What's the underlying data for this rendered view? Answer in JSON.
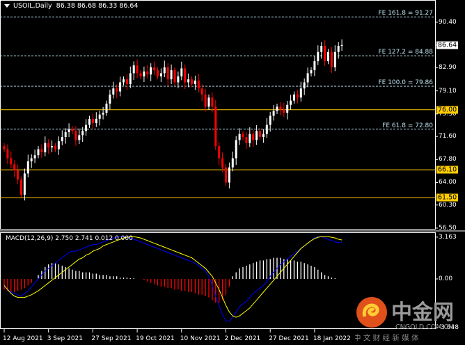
{
  "header": {
    "symbol": "USOIL,Daily",
    "ohlc": "86.38 86.68 86.33 86.64"
  },
  "macd_label": "MACD(12,26,9) 2.750 2.741 0.012 0.000",
  "watermark": {
    "name": "中金网",
    "domain": "CNGOLD.COM.CN",
    "slogan": "中 文 财 经 新 媒 体"
  },
  "colors": {
    "background": "#000000",
    "bull": "#ffffff",
    "bear": "#ff0000",
    "level": "#ffcc00",
    "fe": "#bfe6f2",
    "macd": "#0000ff",
    "signal": "#ffff00"
  },
  "chart_data": [
    {
      "type": "candlestick",
      "title": "USOIL,Daily",
      "ylim": [
        56.5,
        92.5
      ],
      "y_ticks": [
        "90.40",
        "86.64",
        "82.90",
        "79.10",
        "75.30",
        "71.60",
        "67.80",
        "64.00",
        "60.30",
        "56.50"
      ],
      "y_tick_values": [
        90.4,
        86.64,
        82.9,
        79.1,
        75.3,
        71.6,
        67.8,
        64.0,
        60.3,
        56.5
      ],
      "x_ticks": [
        "12 Aug 2021",
        "3 Sep 2021",
        "27 Sep 2021",
        "19 Oct 2021",
        "10 Nov 2021",
        "2 Dec 2021",
        "27 Dec 2021",
        "18 Jan 2022"
      ],
      "x_tick_index": [
        0,
        13,
        26,
        39,
        52,
        65,
        78,
        91
      ],
      "current_price": "86.64",
      "horizontal_levels": [
        {
          "label": "76.00",
          "value": 76.0
        },
        {
          "label": "66.10",
          "value": 66.1
        },
        {
          "label": "61.50",
          "value": 61.5
        }
      ],
      "fib_levels": [
        {
          "label": "FE 161.8 = 91.27",
          "value": 91.27
        },
        {
          "label": "FE 127.2 = 84.88",
          "value": 84.88
        },
        {
          "label": "FE 100.0 = 79.86",
          "value": 79.86
        },
        {
          "label": "FE 61.8 = 72.80",
          "value": 72.8
        }
      ],
      "close": [
        69.5,
        68,
        67,
        66,
        64.5,
        62,
        65.5,
        67.5,
        68,
        68.5,
        69.5,
        69,
        70.5,
        69.8,
        70,
        69.5,
        70.8,
        71.5,
        72.3,
        72.8,
        72.5,
        71,
        71.8,
        72.5,
        73.5,
        74.5,
        73.8,
        74.5,
        75.2,
        75.5,
        77,
        78.5,
        79.5,
        79,
        80.5,
        81,
        80.2,
        82,
        83.3,
        82,
        81.5,
        82.3,
        81.8,
        83,
        82.5,
        81.5,
        82,
        83,
        81,
        82.5,
        80.5,
        81.5,
        82.8,
        80.5,
        81,
        80.2,
        80.8,
        79.5,
        78.5,
        76.5,
        78,
        76.5,
        70,
        68,
        66.5,
        64,
        66.5,
        68,
        71,
        72,
        71.5,
        70.5,
        72,
        71,
        72.5,
        71.5,
        72,
        73.5,
        75,
        75.8,
        76.5,
        76,
        75.5,
        76.8,
        77.5,
        78.5,
        78,
        79.5,
        80.5,
        82,
        82.5,
        84,
        85.5,
        86.5,
        84,
        85.5,
        83,
        85.5,
        86.5,
        86.64
      ]
    },
    {
      "type": "macd",
      "title": "MACD(12,26,9)",
      "ylim": [
        -3.648,
        3.163
      ],
      "y_ticks": [
        "3.163",
        "0.00",
        "-3.648"
      ],
      "macd": [
        -0.6,
        -0.8,
        -1.0,
        -1.1,
        -1.2,
        -1.3,
        -1.1,
        -0.9,
        -0.6,
        -0.3,
        0,
        0.3,
        0.6,
        0.8,
        1.0,
        1.2,
        1.4,
        1.6,
        1.8,
        2.0,
        2.1,
        2.1,
        2.2,
        2.3,
        2.4,
        2.5,
        2.6,
        2.6,
        2.7,
        2.8,
        2.9,
        3.0,
        3.1,
        3.15,
        3.2,
        3.2,
        3.15,
        3.1,
        3.0,
        2.9,
        2.8,
        2.7,
        2.6,
        2.5,
        2.4,
        2.3,
        2.2,
        2.1,
        2.0,
        1.9,
        1.8,
        1.7,
        1.6,
        1.5,
        1.4,
        1.3,
        1.2,
        1.0,
        0.8,
        0.6,
        0.2,
        -0.5,
        -1.3,
        -2.0,
        -2.7,
        -3.2,
        -3.2,
        -2.9,
        -2.5,
        -2.1,
        -1.9,
        -1.7,
        -1.4,
        -1.1,
        -0.9,
        -0.7,
        -0.5,
        -0.2,
        0.2,
        0.5,
        0.8,
        1.1,
        1.3,
        1.5,
        1.7,
        1.9,
        2.1,
        2.3,
        2.5,
        2.7,
        2.9,
        3.1,
        3.2,
        3.2,
        3.1,
        3.0,
        2.9,
        2.8,
        2.75,
        2.75
      ],
      "signal": [
        -0.5,
        -0.8,
        -1.1,
        -1.3,
        -1.4,
        -1.4,
        -1.4,
        -1.3,
        -1.2,
        -1.05,
        -0.9,
        -0.7,
        -0.5,
        -0.3,
        -0.1,
        0.1,
        0.3,
        0.5,
        0.7,
        0.9,
        1.1,
        1.3,
        1.5,
        1.6,
        1.8,
        1.9,
        2.1,
        2.2,
        2.3,
        2.5,
        2.6,
        2.7,
        2.8,
        2.9,
        3.0,
        3.1,
        3.15,
        3.2,
        3.2,
        3.15,
        3.1,
        3.0,
        2.9,
        2.8,
        2.7,
        2.6,
        2.5,
        2.4,
        2.3,
        2.2,
        2.1,
        2.0,
        1.9,
        1.8,
        1.7,
        1.6,
        1.4,
        1.2,
        1.0,
        0.8,
        0.5,
        0.2,
        -0.3,
        -0.8,
        -1.4,
        -2.0,
        -2.5,
        -2.8,
        -2.9,
        -2.8,
        -2.6,
        -2.4,
        -2.2,
        -1.9,
        -1.6,
        -1.3,
        -1.0,
        -0.7,
        -0.4,
        -0.1,
        0.2,
        0.5,
        0.8,
        1.1,
        1.4,
        1.7,
        2.0,
        2.3,
        2.5,
        2.7,
        2.9,
        3.05,
        3.15,
        3.2,
        3.2,
        3.2,
        3.15,
        3.1,
        3.0,
        2.95
      ],
      "histogram": [
        -0.8,
        -0.9,
        -1.0,
        -1.0,
        -0.9,
        -0.8,
        -0.7,
        -0.5,
        -0.3,
        0,
        0.3,
        0.6,
        0.9,
        1.1,
        1.2,
        1.2,
        1.1,
        1.0,
        0.9,
        0.8,
        0.7,
        0.6,
        0.6,
        0.5,
        0.5,
        0.5,
        0.4,
        0.4,
        0.3,
        0.3,
        0.3,
        0.2,
        0.2,
        0.2,
        0.1,
        0.1,
        0.1,
        0.05,
        0.05,
        0,
        0,
        -0.1,
        -0.2,
        -0.3,
        -0.4,
        -0.5,
        -0.6,
        -0.6,
        -0.7,
        -0.7,
        -0.8,
        -0.8,
        -0.9,
        -0.9,
        -1.0,
        -1.0,
        -1.1,
        -1.2,
        -1.2,
        -1.3,
        -1.4,
        -1.6,
        -1.8,
        -1.8,
        -1.6,
        -1.2,
        -0.6,
        0.2,
        0.5,
        0.8,
        0.9,
        1.0,
        1.1,
        1.2,
        1.3,
        1.4,
        1.4,
        1.5,
        1.5,
        1.6,
        1.6,
        1.6,
        1.5,
        1.5,
        1.4,
        1.4,
        1.3,
        1.3,
        1.2,
        1.1,
        1.0,
        0.9,
        0.7,
        0.5,
        0.3,
        0.2,
        0.1,
        0.05,
        0,
        0
      ]
    }
  ]
}
